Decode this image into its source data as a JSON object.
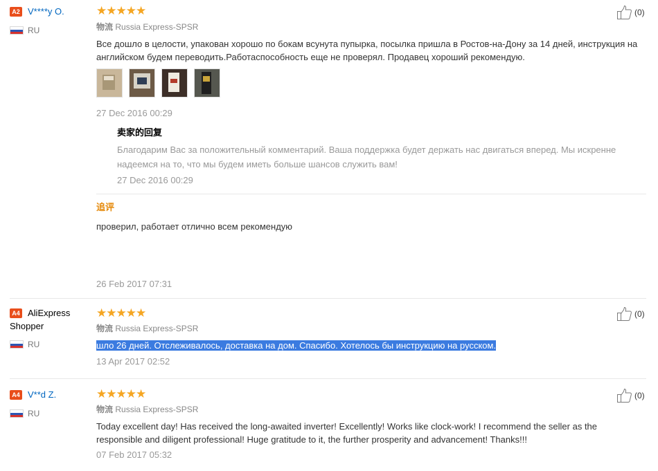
{
  "reviews": [
    {
      "level": "A2",
      "user": "V****y O.",
      "country": "RU",
      "stars": "★★★★★",
      "logistics_label": "物流",
      "logistics": "Russia Express-SPSR",
      "text": "Все дошло в целости, упакован хорошо по бокам всунута пупырка, посылка пришла в Ростов-на-Дону за 14 дней, инструкция на английском будем переводить.Работаспособность еще не проверял. Продавец хороший рекомендую.",
      "date": "27 Dec 2016 00:29",
      "likes": "(0)",
      "seller_reply": {
        "title": "卖家的回复",
        "text": "Благодарим Вас за положительный комментарий. Ваша поддержка будет держать нас двигаться вперед. Мы искренне надеемся на то, что мы будем иметь больше шансов служить вам!",
        "date": "27 Dec 2016 00:29"
      },
      "followup": {
        "title": "追评",
        "text": "проверил, работает отлично всем рекомендую",
        "date": "26 Feb 2017 07:31"
      }
    },
    {
      "level": "A4",
      "user": "AliExpress Shopper",
      "country": "RU",
      "stars": "★★★★★",
      "logistics_label": "物流",
      "logistics": "Russia Express-SPSR",
      "text": "шло 26 дней. Отслеживалось, доставка на дом. Спасибо. Хотелось бы инструкцию на русском.",
      "date": "13 Apr 2017 02:52",
      "likes": "(0)"
    },
    {
      "level": "A4",
      "user": "V**d Z.",
      "country": "RU",
      "stars": "★★★★★",
      "logistics_label": "物流",
      "logistics": "Russia Express-SPSR",
      "text": "Today excellent day! Has received the long-awaited inverter! Excellently! Works like clock-work! I recommend the seller as the responsible and diligent professional! Huge gratitude to it, the further prosperity and advancement! Thanks!!!",
      "date": "07 Feb 2017 05:32",
      "likes": "(0)"
    }
  ],
  "icons": {
    "like": "thumbs-up-icon",
    "flag": "russia-flag-icon",
    "star": "star-icon"
  },
  "colors": {
    "badge": "#e94e1b",
    "stars": "#f5a623",
    "username": "#0066c0",
    "followup": "#e5890a",
    "highlight": "#3b7be0"
  }
}
